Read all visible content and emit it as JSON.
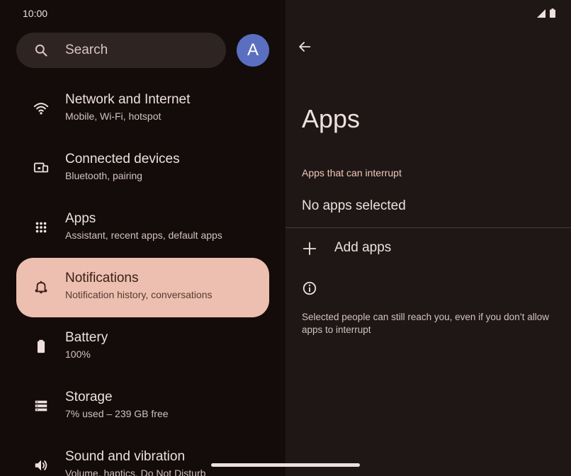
{
  "status_bar": {
    "time": "10:00"
  },
  "search": {
    "placeholder": "Search"
  },
  "account": {
    "avatar_letter": "A",
    "avatar_color": "#5a6fc0"
  },
  "sidebar": {
    "items": [
      {
        "title": "Network and Internet",
        "subtitle": "Mobile, Wi-Fi, hotspot",
        "icon": "wifi-icon"
      },
      {
        "title": "Connected devices",
        "subtitle": "Bluetooth, pairing",
        "icon": "devices-icon"
      },
      {
        "title": "Apps",
        "subtitle": "Assistant, recent apps, default apps",
        "icon": "apps-grid-icon"
      },
      {
        "title": "Notifications",
        "subtitle": "Notification history, conversations",
        "icon": "bell-icon",
        "selected": true
      },
      {
        "title": "Battery",
        "subtitle": "100%",
        "icon": "battery-icon"
      },
      {
        "title": "Storage",
        "subtitle": "7% used – 239 GB free",
        "icon": "storage-icon"
      },
      {
        "title": "Sound and vibration",
        "subtitle": "Volume, haptics, Do Not Disturb",
        "icon": "volume-icon"
      }
    ]
  },
  "detail": {
    "title": "Apps",
    "section_label": "Apps that can interrupt",
    "empty_state": "No apps selected",
    "add_label": "Add apps",
    "footer": "Selected people can still reach you, even if you don’t allow apps to interrupt"
  },
  "colors": {
    "accent": "#ecbfb0",
    "section_label": "#f2c8bb",
    "background": "#130c0b"
  }
}
